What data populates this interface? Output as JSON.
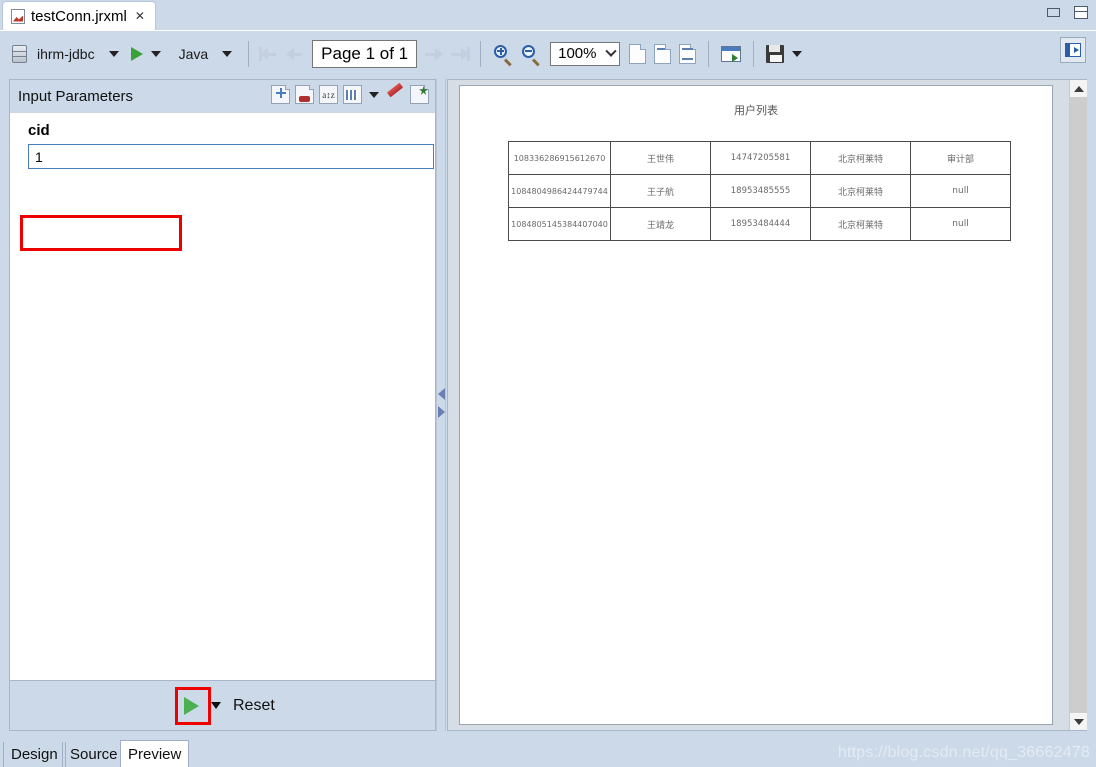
{
  "window": {
    "minimize_label": "Minimize",
    "restore_label": "Restore"
  },
  "document_tab": {
    "title": "testConn.jrxml",
    "close_glyph": "✕",
    "icon": "jrxml-file-icon"
  },
  "toolbar": {
    "datasource_icon": "database-icon",
    "datasource_label": "ihrm-jdbc",
    "datasource_caret": "▼",
    "run_caret": "▼",
    "language_label": "Java",
    "language_caret": "▼",
    "page_indicator": "Page 1 of 1",
    "zoom_in_icon": "zoom-in-icon",
    "zoom_out_icon": "zoom-out-icon",
    "zoom_value": "100%",
    "zoom_caret": "⌄",
    "view_single_page_icon": "single-page-icon",
    "view_actual_size_icon": "actual-size-icon",
    "view_fit_page_icon": "fit-page-icon",
    "export_icon": "export-icon",
    "save_icon": "save-icon",
    "save_caret": "▼",
    "toggle_panel_icon": "toggle-panel-icon"
  },
  "input_parameters": {
    "title": "Input Parameters",
    "tools": [
      {
        "name": "add-parameter-icon"
      },
      {
        "name": "remove-parameter-icon"
      },
      {
        "name": "sort-parameters-icon",
        "glyph": "a↕z"
      },
      {
        "name": "parameter-set-icon"
      },
      {
        "name": "parameter-set-caret",
        "glyph": "▼"
      },
      {
        "name": "clear-parameters-icon"
      },
      {
        "name": "new-parameter-icon"
      }
    ],
    "fields": [
      {
        "label": "cid",
        "value": "1",
        "placeholder": ""
      }
    ],
    "footer": {
      "run_icon": "run-report-icon",
      "run_caret": "▼",
      "reset_label": "Reset"
    }
  },
  "splitter": {
    "collapse_left_icon": "collapse-left-icon",
    "collapse_right_icon": "collapse-right-icon"
  },
  "preview": {
    "report": {
      "title": "用户列表",
      "rows": [
        {
          "id": "108336286915612670",
          "name": "王世伟",
          "tel": "14747205581",
          "company": "北京柯莱特",
          "dept": "审计部"
        },
        {
          "id": "1084804986424479744",
          "name": "王子航",
          "tel": "18953485555",
          "company": "北京柯莱特",
          "dept": "null"
        },
        {
          "id": "1084805145384407040",
          "name": "王靖龙",
          "tel": "18953484444",
          "company": "北京柯莱特",
          "dept": "null"
        }
      ]
    },
    "scrollbar": {
      "up_icon": "scroll-up-icon",
      "down_icon": "scroll-down-icon"
    }
  },
  "bottom_tabs": {
    "items": [
      {
        "label": "Design",
        "selected": false
      },
      {
        "label": "Source",
        "selected": false
      },
      {
        "label": "Preview",
        "selected": true
      }
    ]
  },
  "watermark": {
    "text": "https://blog.csdn.net/qq_36662478"
  },
  "colors": {
    "chrome": "#ccd9e8",
    "accent_blue": "#4a7cbf",
    "run_green": "#4caf50",
    "highlight_red": "#ee0000"
  }
}
